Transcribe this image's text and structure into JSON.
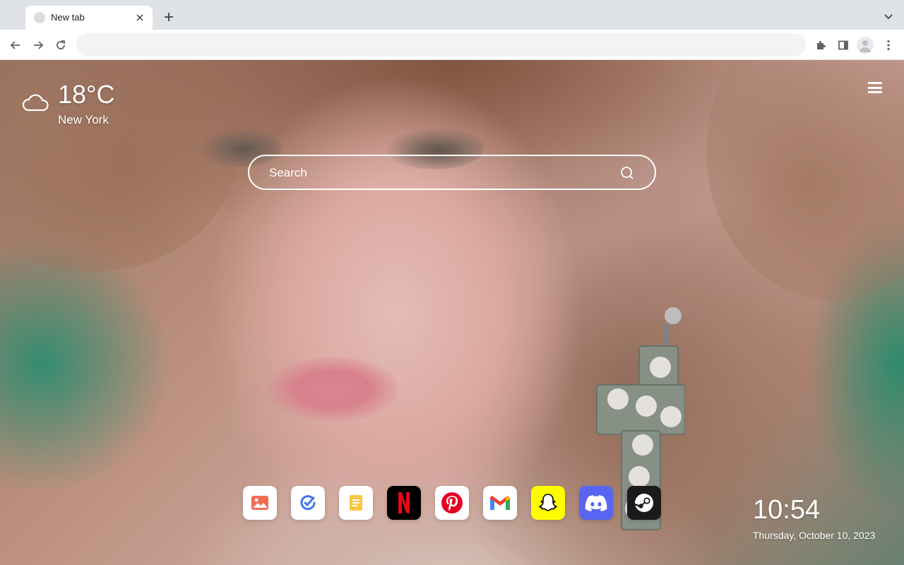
{
  "browser": {
    "tab": {
      "title": "New tab"
    },
    "omnibox": {
      "value": "",
      "placeholder": ""
    }
  },
  "weather": {
    "temperature": "18°C",
    "city": "New York",
    "icon": "cloud-icon"
  },
  "search": {
    "placeholder": "Search"
  },
  "shortcuts": [
    {
      "name": "Photos",
      "icon": "photo-icon",
      "color": "#ffffff"
    },
    {
      "name": "Tasks",
      "icon": "check-icon",
      "color": "#ffffff"
    },
    {
      "name": "Notes",
      "icon": "notes-icon",
      "color": "#ffffff"
    },
    {
      "name": "Netflix",
      "icon": "netflix-icon",
      "color": "#000000"
    },
    {
      "name": "Pinterest",
      "icon": "pinterest-icon",
      "color": "#ffffff"
    },
    {
      "name": "Gmail",
      "icon": "gmail-icon",
      "color": "#ffffff"
    },
    {
      "name": "Snapchat",
      "icon": "snapchat-icon",
      "color": "#fffc00"
    },
    {
      "name": "Discord",
      "icon": "discord-icon",
      "color": "#5865f2"
    },
    {
      "name": "Steam",
      "icon": "steam-icon",
      "color": "#1b1b1b"
    }
  ],
  "clock": {
    "time": "10:54",
    "date": "Thursday, October 10, 2023"
  }
}
